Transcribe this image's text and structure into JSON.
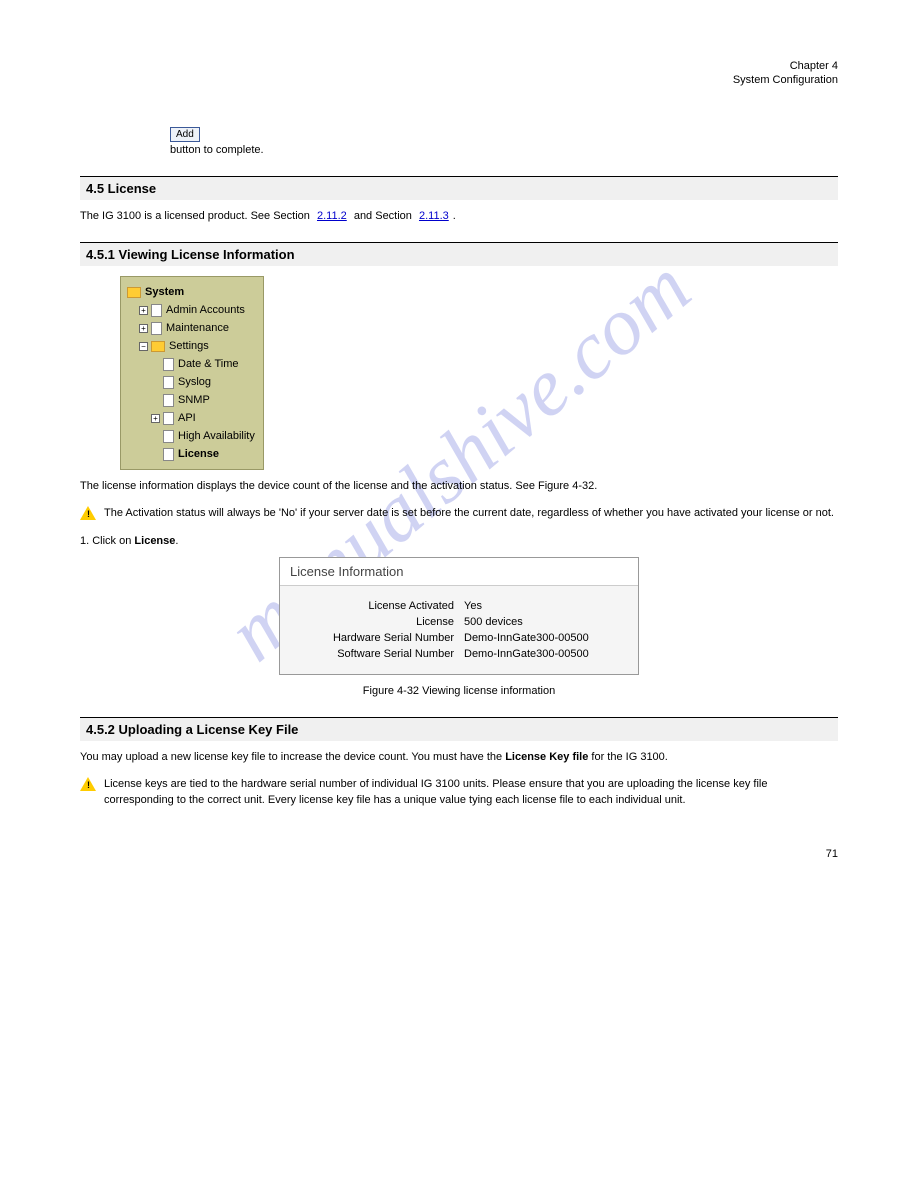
{
  "header": {
    "chapter": "Chapter 4",
    "subtitle": "System Configuration"
  },
  "addBtn": "Add",
  "intro1": "button to complete.",
  "section1": {
    "title": "4.5 License",
    "para1": "The IG 3100 is a licensed product. See Section ",
    "link1": "2.11.2",
    "para2": " and Section ",
    "link2": "2.11.3",
    "period": "."
  },
  "section2": {
    "title": "4.5.1 Viewing License Information",
    "tree": {
      "root": "System",
      "n1": "Admin Accounts",
      "n2": "Maintenance",
      "n3": "Settings",
      "c1": "Date & Time",
      "c2": "Syslog",
      "c3": "SNMP",
      "c4": "API",
      "c5": "High Availability",
      "c6": "License"
    },
    "p1": "The license information displays the device count of the license and the activation status. See Figure 4-32.",
    "warn": "The Activation status will always be 'No' if your server date is set before the current date, regardless of whether you have activated your license or not.",
    "step1": "1. Click on ",
    "step1b": "License",
    "step1c": "."
  },
  "license": {
    "title": "License Information",
    "r1l": "License Activated",
    "r1v": "Yes",
    "r2l": "License",
    "r2v": "500 devices",
    "r3l": "Hardware Serial Number",
    "r3v": "Demo-InnGate300-00500",
    "r4l": "Software Serial Number",
    "r4v": "Demo-InnGate300-00500"
  },
  "figCaption": "Figure 4-32 Viewing license information",
  "section3": {
    "title": "4.5.2 Uploading a License Key File",
    "p1a": "You may upload a new license key file to increase the device count. You must have the ",
    "p1b": "License Key file",
    "p1c": " for the IG 3100.",
    "warn": "License keys are tied to the hardware serial number of individual IG 3100 units. Please ensure that you are uploading the license key file corresponding to the correct unit. Every license key file has a unique value tying each license file to each individual unit."
  },
  "footerPage": "71"
}
